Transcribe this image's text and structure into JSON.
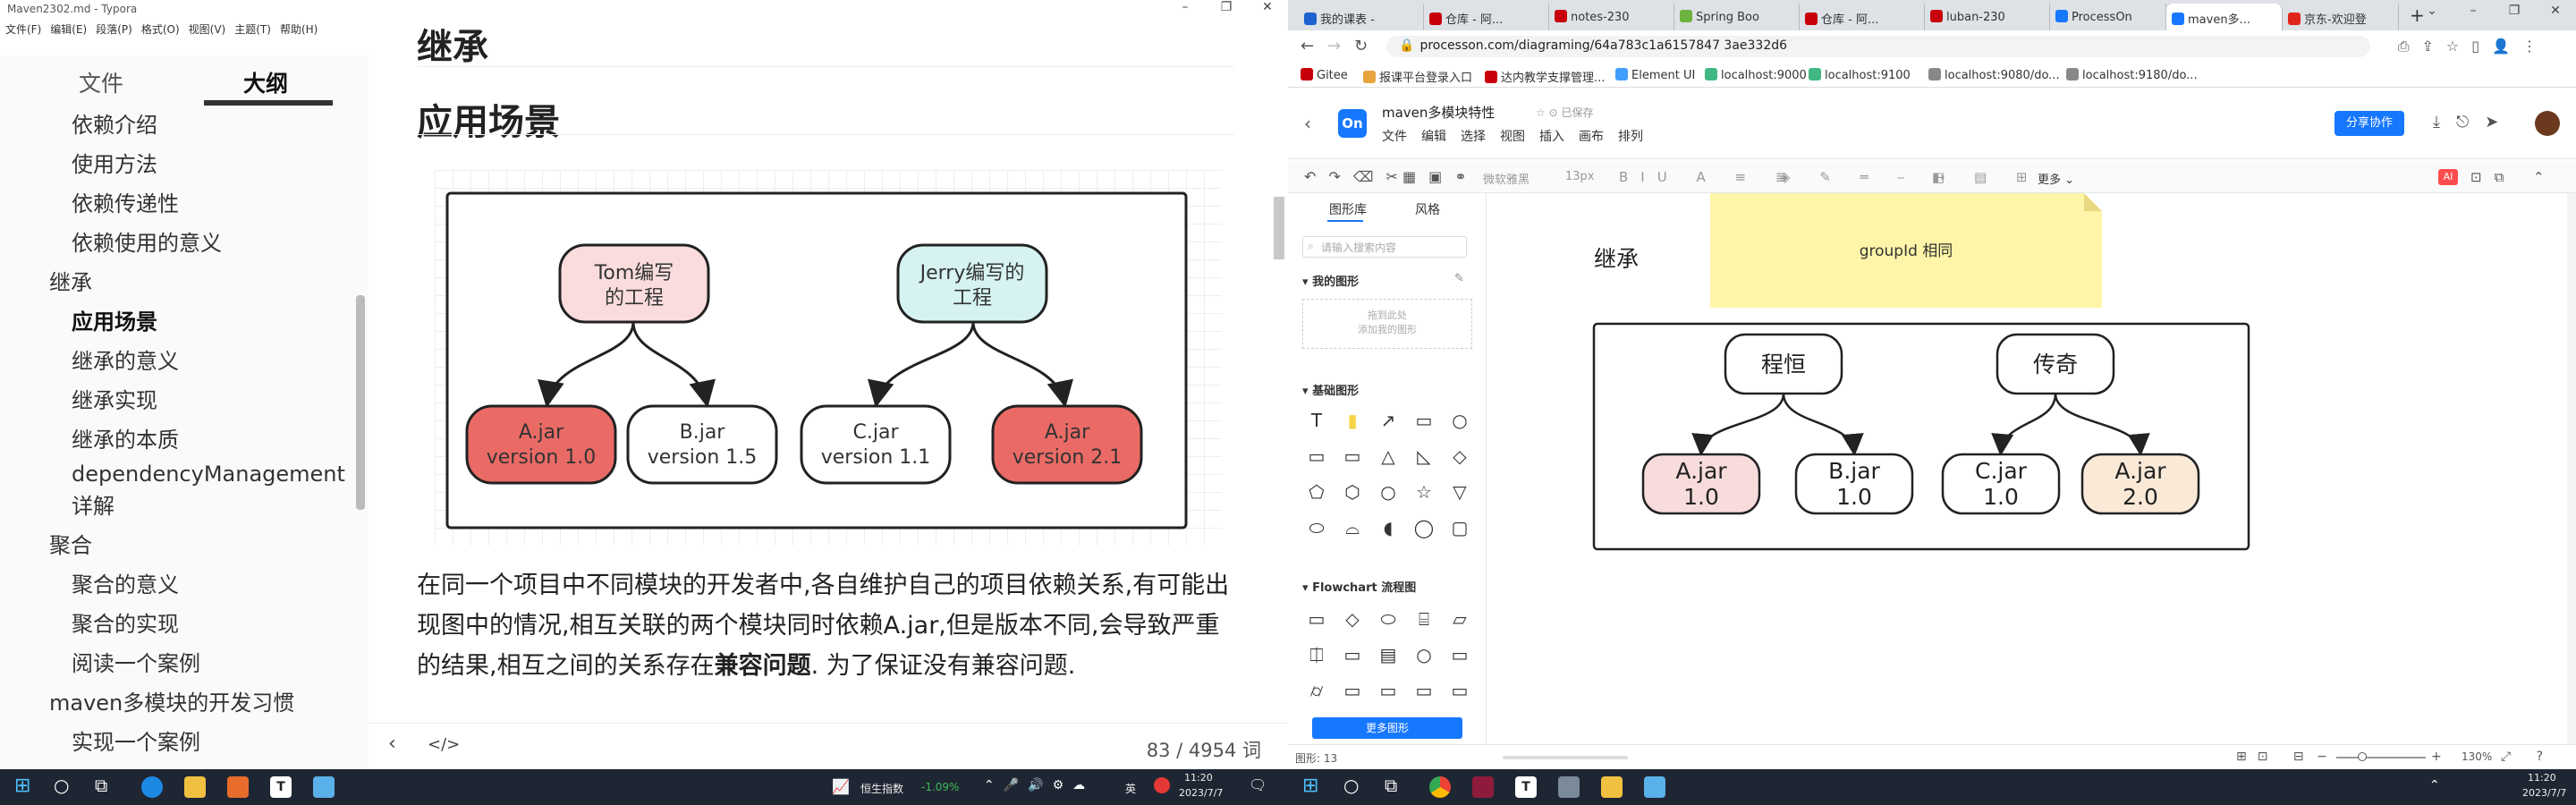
{
  "typora": {
    "window_title": "Maven2302.md - Typora",
    "menu": [
      "文件(F)",
      "编辑(E)",
      "段落(P)",
      "格式(O)",
      "视图(V)",
      "主题(T)",
      "帮助(H)"
    ],
    "sidebar_tabs": [
      "文件",
      "大纲"
    ],
    "outline": [
      {
        "label": "依赖介绍",
        "level": 2
      },
      {
        "label": "使用方法",
        "level": 2
      },
      {
        "label": "依赖传递性",
        "level": 2
      },
      {
        "label": "依赖使用的意义",
        "level": 2
      },
      {
        "label": "继承",
        "level": 1
      },
      {
        "label": "应用场景",
        "level": 2,
        "active": true
      },
      {
        "label": "继承的意义",
        "level": 2
      },
      {
        "label": "继承实现",
        "level": 2
      },
      {
        "label": "继承的本质",
        "level": 2
      },
      {
        "label": "dependencyManagement",
        "level": 2
      },
      {
        "label": "详解",
        "level": 2
      },
      {
        "label": "聚合",
        "level": 1
      },
      {
        "label": "聚合的意义",
        "level": 2
      },
      {
        "label": "聚合的实现",
        "level": 2
      },
      {
        "label": "阅读一个案例",
        "level": 2
      },
      {
        "label": "maven多模块的开发习惯",
        "level": 1
      },
      {
        "label": "实现一个案例",
        "level": 2
      }
    ],
    "heading_top": "继承",
    "heading": "应用场景",
    "diagram1": {
      "tom": "Tom编写\n的工程",
      "jerry": "Jerry编写的\n工程",
      "nodes": [
        "A.jar\nversion 1.0",
        "B.jar\nversion 1.5",
        "C.jar\nversion 1.1",
        "A.jar\nversion 2.1"
      ]
    },
    "paragraph_1": "在同一个项目中不同模块的开发者中,各自维护自己的项目依赖关系,有可能出现图中的情况,相互关联的两个模块同时依赖A.jar,但是版本不同,会导致严重的结果,相互之间的关系存在",
    "paragraph_bold": "兼容问题",
    "paragraph_2": ". 为了保证没有兼容问题.",
    "word_count": "83 / 4954 词"
  },
  "browser": {
    "tabs": [
      {
        "label": "我的课表 -",
        "color": "#1e62d0"
      },
      {
        "label": "仓库 - 阿...",
        "color": "#c7000b"
      },
      {
        "label": "notes-230",
        "color": "#c7000b"
      },
      {
        "label": "Spring Boo",
        "color": "#6db33f"
      },
      {
        "label": "仓库 - 阿...",
        "color": "#c7000b"
      },
      {
        "label": "luban-230",
        "color": "#c7000b"
      },
      {
        "label": "ProcessOn",
        "color": "#1677ff"
      },
      {
        "label": "maven多...",
        "color": "#1677ff",
        "active": true
      },
      {
        "label": "京东-欢迎登",
        "color": "#e1251b"
      }
    ],
    "url": "processon.com/diagraming/64a783c1a6157847 3ae332d6",
    "bookmarks": [
      "Gitee",
      "报课平台登录入口",
      "达内教学支撑管理...",
      "Element UI",
      "localhost:9000",
      "localhost:9100",
      "localhost:9080/do...",
      "localhost:9180/do..."
    ]
  },
  "processon": {
    "doc_title": "maven多模块特性",
    "saved": "已保存",
    "menu": [
      "文件",
      "编辑",
      "选择",
      "视图",
      "插入",
      "画布",
      "排列"
    ],
    "share": "分享协作",
    "toolbar_font": "微软雅黑",
    "toolbar_size": "13px",
    "toolbar_more": "更多",
    "lib_tabs": [
      "图形库",
      "风格"
    ],
    "search_placeholder": "请输入搜索内容",
    "my_shapes": "我的图形",
    "drop_hint_1": "拖到此处",
    "drop_hint_2": "添加我的图形",
    "basic_shapes": "基础图形",
    "flowchart": "Flowchart 流程图",
    "more_shapes": "更多图形",
    "sticky_note": "groupId 相同",
    "inherit_label": "继承",
    "diagram2": {
      "left_parent": "程恒",
      "right_parent": "传奇",
      "nodes": [
        "A.jar\n1.0",
        "B.jar\n1.0",
        "C.jar\n1.0",
        "A.jar\n2.0"
      ]
    },
    "status_shapes": "图形: 13",
    "zoom": "130%"
  },
  "taskbar": {
    "stock": "恒生指数",
    "stock_change": "-1.09%",
    "ime": "英",
    "time_left": "11:20",
    "date_left": "2023/7/7",
    "time_right": "11:20",
    "date_right": "2023/7/7"
  }
}
